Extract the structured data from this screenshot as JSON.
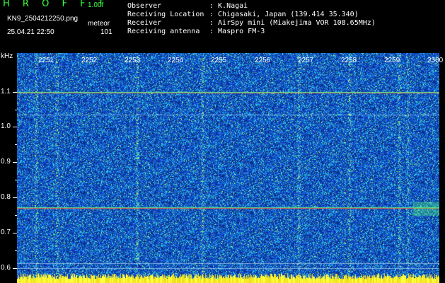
{
  "header": {
    "logo": "H R O F F T",
    "version": "1.00f",
    "filename": "KN9_2504212250.png",
    "mode": "meteor",
    "datetime": "25.04.21 22:50",
    "count": "101"
  },
  "info": {
    "observer_label": "Observer",
    "observer_value": ": K.Nagai",
    "location_label": "Receiving Location",
    "location_value": ": Chigasaki, Japan (139.414 35.340)",
    "receiver_label": "Receiver",
    "receiver_value": ": AirSpy mini (Miakejima VOR 108.65MHz)",
    "antenna_label": "Receiving antenna",
    "antenna_value": ": Maspro FM-3"
  },
  "axis": {
    "y_unit": "kHz",
    "y_ticks": [
      "1.1",
      "1.0",
      "0.9",
      "0.8",
      "0.7",
      "0.6"
    ],
    "x_ticks": [
      "2251",
      "2252",
      "2253",
      "2254",
      "2255",
      "2256",
      "2257",
      "2258",
      "2259",
      "2300"
    ]
  },
  "colors": {
    "background": "#000000",
    "header_green": "#39ff3c",
    "text_white": "#ffffff",
    "spectrogram_base": "#1b3fb8",
    "signal_red": "#ff3030",
    "signal_green": "#40ff80",
    "noise_yellow": "#ffff40"
  }
}
